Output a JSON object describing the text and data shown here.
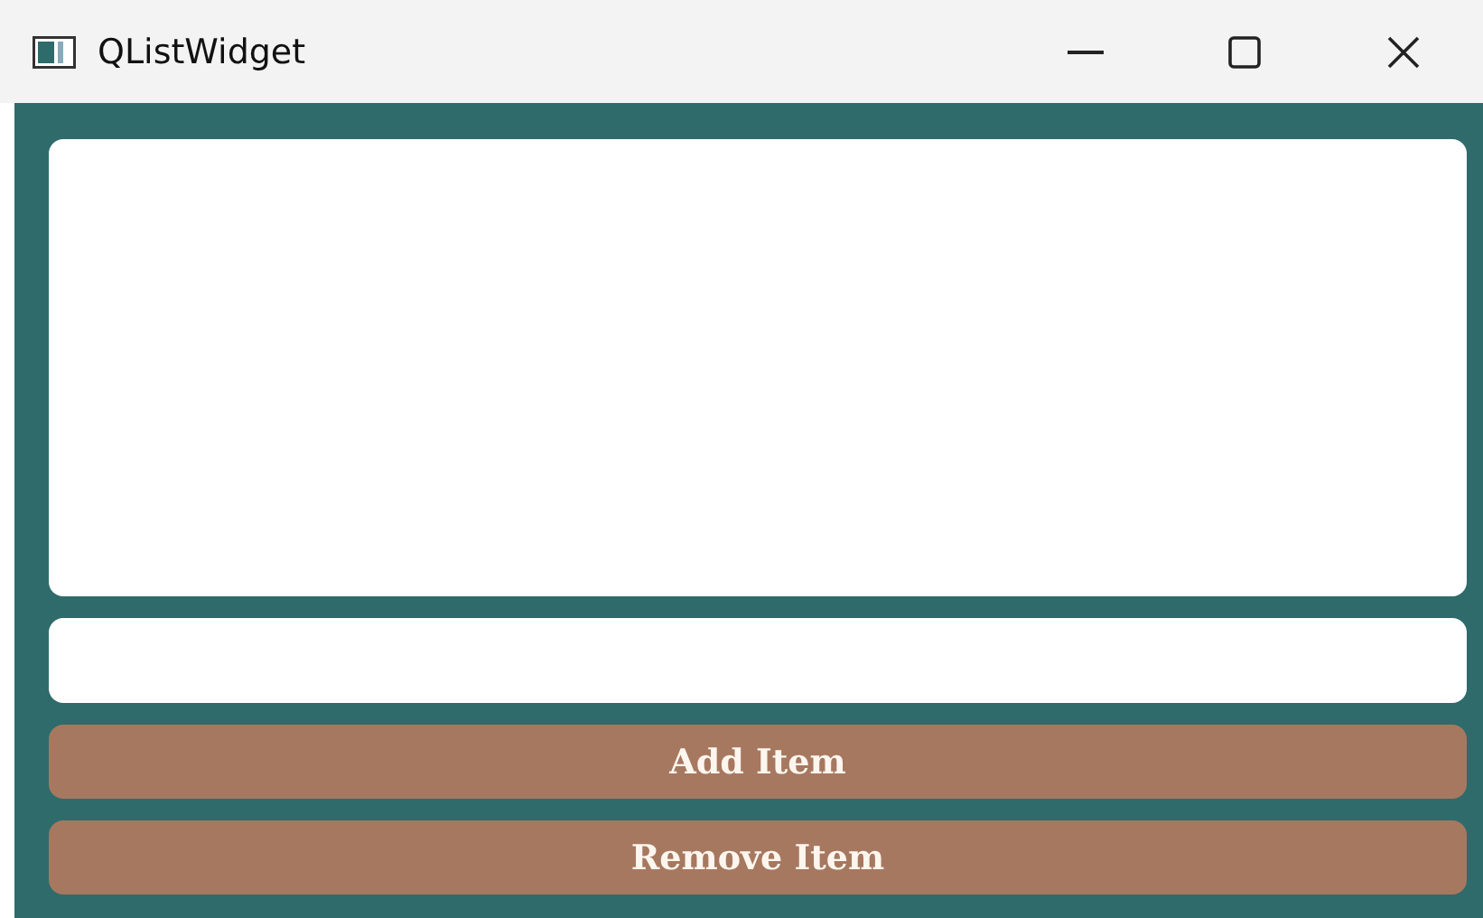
{
  "window": {
    "title": "QListWidget"
  },
  "list": {
    "kind": "list"
  },
  "input": {
    "kind": "field"
  },
  "buttons": [
    "Add Item",
    "Remove Item"
  ]
}
